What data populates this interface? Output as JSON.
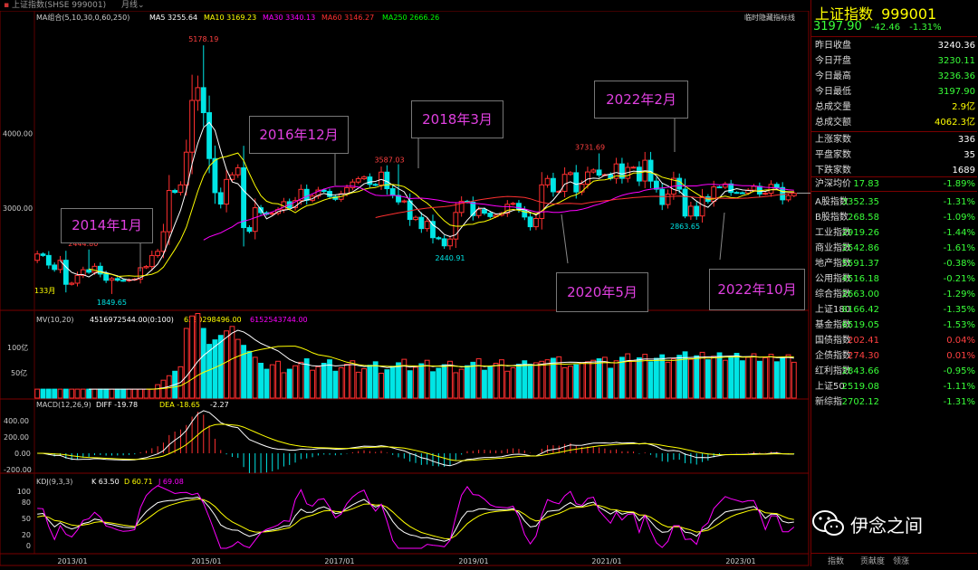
{
  "topbar": {
    "title": "上证指数(SHSE 999001)",
    "period": "月线"
  },
  "ma_legend": {
    "group": "MA组合(5,10,30,0,60,250)",
    "ma5": "MA5 3255.64",
    "ma10": "MA10 3169.23",
    "ma30": "MA30 3340.13",
    "ma60": "MA60 3146.27",
    "ma250": "MA250 2666.26",
    "hide": "临时隐藏指标线"
  },
  "price_labels": {
    "p4000": "4000.00",
    "p3000": "3000.00",
    "high2015": "5178.19",
    "low2014": "1849.65",
    "high2013": "2444.80",
    "h2018": "3587.03",
    "l2019": "2440.91",
    "h2021": "3731.69",
    "l2022": "2863.65",
    "cnt": "133月"
  },
  "annotations": {
    "a2014": "2014年1月",
    "a2016": "2016年12月",
    "a2018": "2018年3月",
    "a2022a": "2022年2月",
    "a2020": "2020年5月",
    "a2022b": "2022年10月"
  },
  "mv_legend": {
    "name": "MV(10,20)",
    "v1": "4516972544.00(0:100)",
    "v2": "6280298496.00",
    "v3": "6152543744.00",
    "t100": "100亿",
    "t50": "50亿"
  },
  "macd_legend": {
    "name": "MACD(12,26,9)",
    "diff": "DIFF -19.78",
    "dea": "DEA -18.65",
    "macd": "-2.27",
    "t400": "400.00",
    "t200": "200.00",
    "t0": "0.00",
    "tn200": "-200.00"
  },
  "kdj_legend": {
    "name": "KDJ(9,3,3)",
    "k": "K 63.50",
    "d": "D 60.71",
    "j": "J 69.08",
    "t100": "100",
    "t80": "80",
    "t50": "50",
    "t20": "20",
    "t0": "0"
  },
  "xaxis": [
    "2013/01",
    "2015/01",
    "2017/01",
    "2019/01",
    "2021/01",
    "2023/01"
  ],
  "panel": {
    "title": "上证指数",
    "code": "999001",
    "price": "3197.90",
    "change": "-42.46",
    "pct": "-1.31%",
    "stats": [
      {
        "label": "昨日收盘",
        "value": "3240.36",
        "color": "#ffffff"
      },
      {
        "label": "今日开盘",
        "value": "3230.11",
        "color": "#39ff39"
      },
      {
        "label": "今日最高",
        "value": "3236.36",
        "color": "#39ff39"
      },
      {
        "label": "今日最低",
        "value": "3197.90",
        "color": "#39ff39"
      },
      {
        "label": "总成交量",
        "value": "2.9亿",
        "color": "#ffff00"
      },
      {
        "label": "总成交额",
        "value": "4062.3亿",
        "color": "#ffff00"
      }
    ],
    "counts": [
      {
        "label": "上涨家数",
        "value": "336"
      },
      {
        "label": "平盘家数",
        "value": "35"
      },
      {
        "label": "下跌家数",
        "value": "1689"
      }
    ],
    "indices": [
      {
        "label": "沪深均价",
        "value": "17.83",
        "pct": "-1.89%",
        "color": "#39ff39"
      },
      {
        "label": "A股指数",
        "value": "3352.35",
        "pct": "-1.31%",
        "color": "#39ff39"
      },
      {
        "label": "B股指数",
        "value": "268.58",
        "pct": "-1.09%",
        "color": "#39ff39"
      },
      {
        "label": "工业指数",
        "value": "2919.26",
        "pct": "-1.44%",
        "color": "#39ff39"
      },
      {
        "label": "商业指数",
        "value": "2542.86",
        "pct": "-1.61%",
        "color": "#39ff39"
      },
      {
        "label": "地产指数",
        "value": "5591.37",
        "pct": "-0.38%",
        "color": "#39ff39"
      },
      {
        "label": "公用指数",
        "value": "4516.18",
        "pct": "-0.21%",
        "color": "#39ff39"
      },
      {
        "label": "综合指数",
        "value": "2663.00",
        "pct": "-1.29%",
        "color": "#39ff39"
      },
      {
        "label": "上证180",
        "value": "8166.42",
        "pct": "-1.35%",
        "color": "#39ff39"
      },
      {
        "label": "基金指数",
        "value": "6519.05",
        "pct": "-1.53%",
        "color": "#39ff39"
      },
      {
        "label": "国债指数",
        "value": "202.41",
        "pct": "0.04%",
        "color": "#ff4040"
      },
      {
        "label": "企债指数",
        "value": "274.30",
        "pct": "0.01%",
        "color": "#ff4040"
      },
      {
        "label": "红利指数",
        "value": "2843.66",
        "pct": "-0.95%",
        "color": "#39ff39"
      },
      {
        "label": "上证50",
        "value": "2519.08",
        "pct": "-1.11%",
        "color": "#39ff39"
      },
      {
        "label": "新综指",
        "value": "2702.12",
        "pct": "-1.31%",
        "color": "#39ff39"
      }
    ],
    "tabs": [
      "指数",
      "贡献度",
      "领涨"
    ],
    "watermark": "伊念之间"
  },
  "colors": {
    "up": "#ff3030",
    "down": "#00e5e5",
    "ma5": "#ffffff",
    "ma10": "#ffff00",
    "ma30": "#ff00ff",
    "ma60": "#ff3030",
    "ma250": "#00ff00"
  },
  "chart_data": {
    "type": "candlestick",
    "period": "monthly",
    "closes": [
      2385,
      2365,
      2237,
      2177,
      2301,
      1979,
      1994,
      2098,
      2174,
      2141,
      2220,
      2116,
      2033,
      2056,
      2033,
      2026,
      2039,
      2048,
      2201,
      2217,
      2364,
      2420,
      2683,
      3235,
      3210,
      3310,
      3748,
      4441,
      4612,
      4277,
      3663,
      3206,
      3053,
      3383,
      3445,
      3539,
      2738,
      2688,
      3004,
      2938,
      2917,
      2930,
      2979,
      3085,
      3005,
      3100,
      3250,
      3104,
      3159,
      3241,
      3223,
      3154,
      3117,
      3192,
      3273,
      3348,
      3393,
      3416,
      3317,
      3307,
      3481,
      3259,
      3169,
      3082,
      3095,
      2847,
      2876,
      2725,
      2821,
      2603,
      2588,
      2494,
      2585,
      2941,
      3091,
      3078,
      2899,
      2979,
      2932,
      2886,
      2905,
      2929,
      3050,
      3063,
      2977,
      2880,
      2750,
      2860,
      3310,
      3396,
      3218,
      3224,
      3451,
      3473,
      3216,
      3320,
      3483,
      3509,
      3441,
      3447,
      3397,
      3591,
      3398,
      3544,
      3547,
      3362,
      3640,
      3361,
      3252,
      3047,
      3186,
      3398,
      3253,
      2893,
      3024,
      2894,
      3151,
      3089,
      3283,
      3279,
      3323,
      3209,
      3205,
      3200,
      3240,
      3291,
      3188,
      3198,
      3317,
      3275,
      3110,
      3166,
      3198
    ],
    "annotations": [
      "2014年1月",
      "2016年12月",
      "2018年3月",
      "2020年5月",
      "2022年2月",
      "2022年10月"
    ],
    "notable_values": {
      "high": 5178.19,
      "low": 1849.65,
      "h2013": 2444.8,
      "h2018": 3587.03,
      "l2019": 2440.91,
      "h2021": 3731.69,
      "l2022": 2863.65
    }
  }
}
